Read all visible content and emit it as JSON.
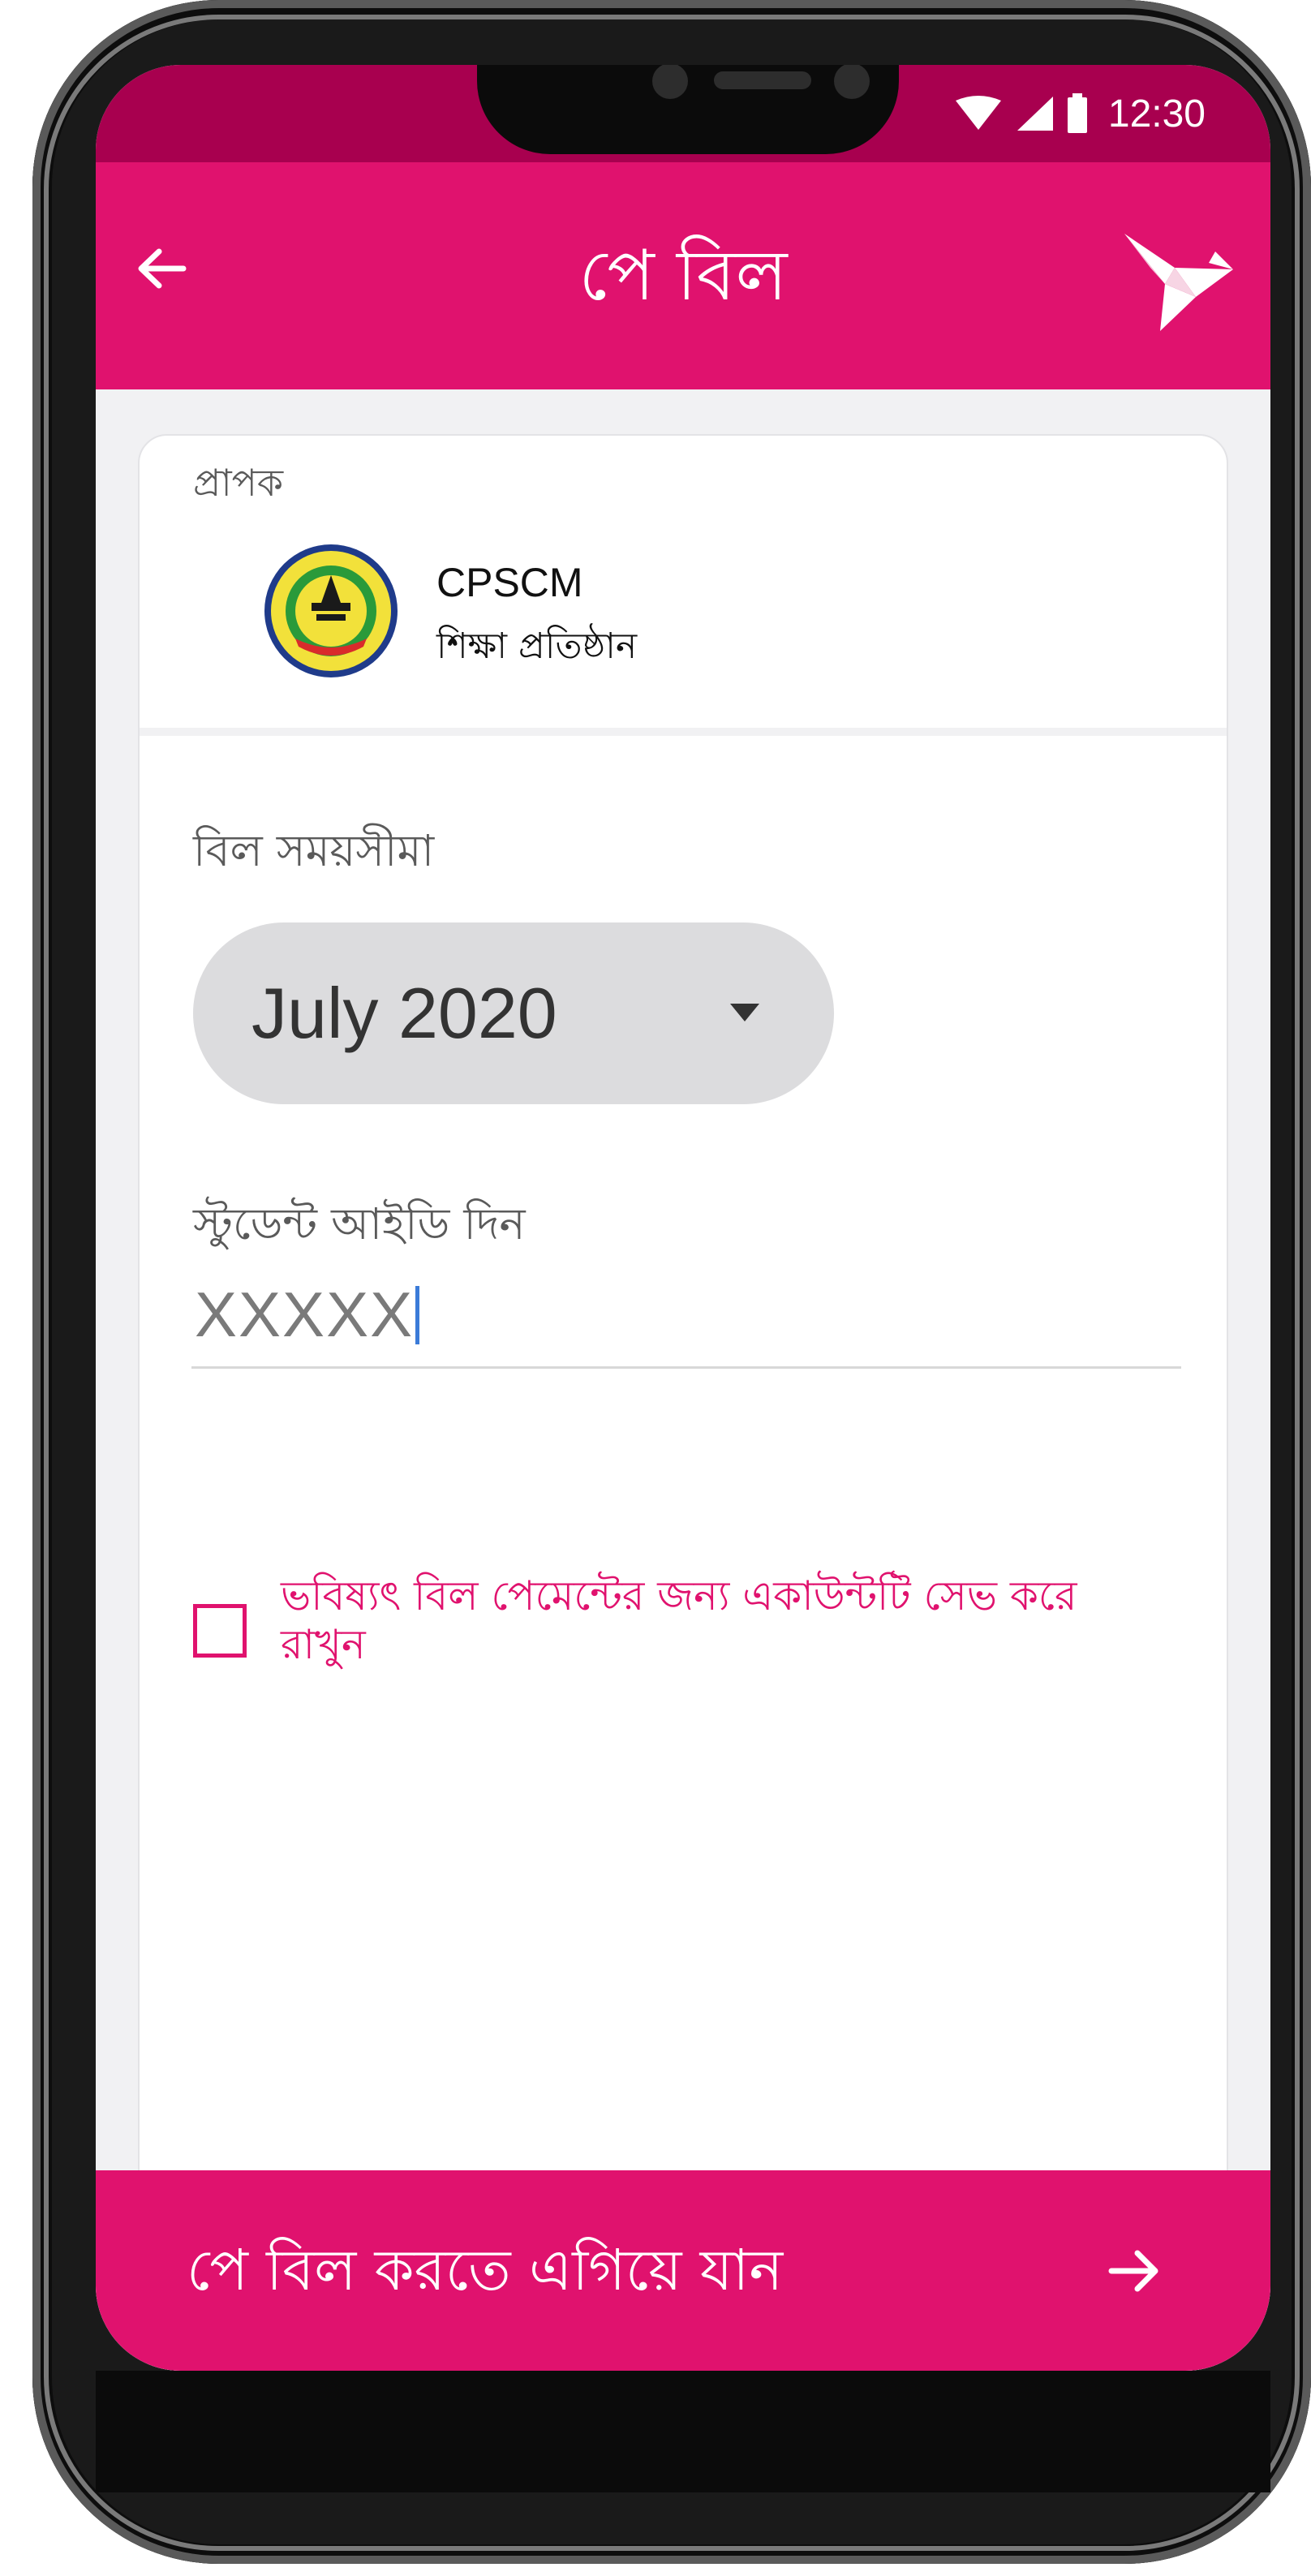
{
  "status_bar": {
    "time": "12:30",
    "icons": [
      "wifi-icon",
      "cellular-icon",
      "battery-icon"
    ]
  },
  "app_bar": {
    "title": "পে বিল",
    "back_icon": "arrow-left-icon",
    "logo_icon": "paper-bird-icon"
  },
  "recipient": {
    "label": "প্রাপক",
    "name": "CPSCM",
    "type": "শিক্ষা প্রতিষ্ঠান",
    "logo_icon": "institution-emblem-icon"
  },
  "bill_period": {
    "label": "বিল সময়সীমা",
    "selected": "July 2020"
  },
  "student_id": {
    "label": "স্টুডেন্ট আইডি দিন",
    "value": "XXXXX"
  },
  "save_account": {
    "checked": false,
    "label": "ভবিষ্যৎ বিল পেমেন্টের জন্য একাউন্টটি সেভ করে রাখুন"
  },
  "proceed": {
    "label": "পে বিল করতে এগিয়ে যান"
  },
  "colors": {
    "brand": "#e0126e",
    "brand_dark": "#a8004f",
    "select_bg": "#dcdcde",
    "background": "#f1f1f3"
  }
}
